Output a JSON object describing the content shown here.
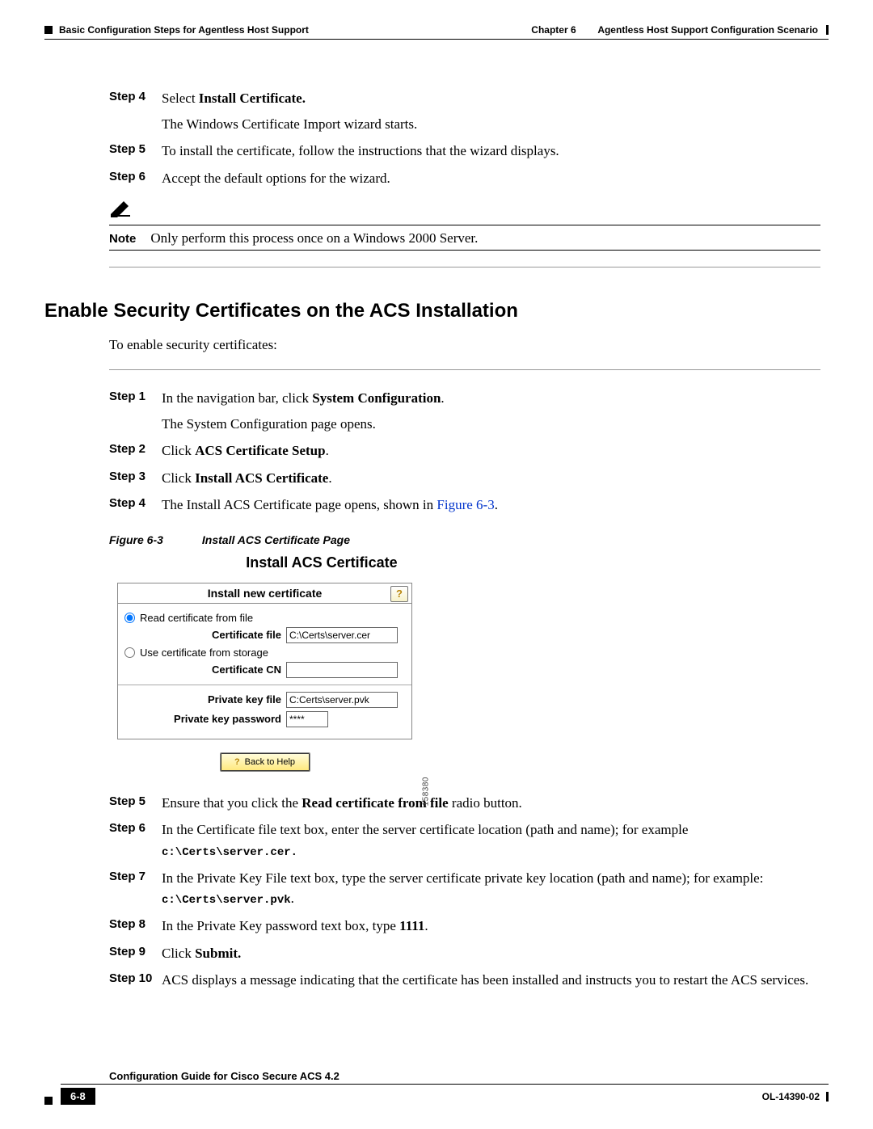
{
  "header": {
    "left": "Basic Configuration Steps for Agentless Host Support",
    "chapter": "Chapter 6",
    "title": "Agentless Host Support Configuration Scenario"
  },
  "section1": {
    "steps": {
      "s4": {
        "label": "Step 4",
        "pre": "Select ",
        "bold": "Install Certificate.",
        "post": "",
        "sub": "The Windows Certificate Import wizard starts."
      },
      "s5": {
        "label": "Step 5",
        "text": "To install the certificate, follow the instructions that the wizard displays."
      },
      "s6": {
        "label": "Step 6",
        "text": "Accept the default options for the wizard."
      }
    },
    "note": {
      "label": "Note",
      "text": "Only perform this process once on a Windows 2000 Server."
    }
  },
  "h2": "Enable Security Certificates on the ACS Installation",
  "section2_intro": "To enable security certificates:",
  "section2": {
    "s1": {
      "label": "Step 1",
      "pre": "In the navigation bar, click ",
      "bold": "System Configuration",
      "post": ".",
      "sub": "The System Configuration page opens."
    },
    "s2": {
      "label": "Step 2",
      "pre": "Click ",
      "bold": "ACS Certificate Setup",
      "post": "."
    },
    "s3": {
      "label": "Step 3",
      "pre": "Click ",
      "bold": "Install ACS Certificate",
      "post": "."
    },
    "s4": {
      "label": "Step 4",
      "pre": "The Install ACS Certificate page opens, shown in ",
      "link": "Figure 6-3",
      "post": "."
    }
  },
  "figure": {
    "num": "Figure 6-3",
    "caption": "Install ACS Certificate Page",
    "title": "Install ACS Certificate"
  },
  "cert": {
    "head": "Install new certificate",
    "help": "?",
    "radio1": "Read certificate from file",
    "cert_file_label": "Certificate file",
    "cert_file_value": "C:\\Certs\\server.cer",
    "radio2": "Use certificate from storage",
    "cert_cn_label": "Certificate CN",
    "cert_cn_value": "",
    "pk_file_label": "Private key file",
    "pk_file_value": "C:Certs\\server.pvk",
    "pk_pwd_label": "Private key password",
    "pk_pwd_value": "****",
    "back_help": "Back to Help",
    "side_num": "158380"
  },
  "section3": {
    "s5": {
      "label": "Step 5",
      "pre": "Ensure that you click the ",
      "bold": "Read certificate from file",
      "post": " radio button."
    },
    "s6": {
      "label": "Step 6",
      "pre": "In the Certificate file text box, enter the server certificate location (path and name); for example ",
      "mono": "c:\\Certs\\server.cer.",
      "post": ""
    },
    "s7": {
      "label": "Step 7",
      "pre": "In the Private Key File text box, type the server certificate private key location (path and name); for example: ",
      "mono": "c:\\Certs\\server.pvk",
      "post": "."
    },
    "s8": {
      "label": "Step 8",
      "pre": "In the Private Key password text box, type ",
      "bold": "1111",
      "post": "."
    },
    "s9": {
      "label": "Step 9",
      "pre": "Click ",
      "bold": "Submit.",
      "post": ""
    },
    "s10": {
      "label": "Step 10",
      "text": "ACS displays a message indicating that the certificate has been installed and instructs you to restart the ACS services."
    }
  },
  "footer": {
    "title": "Configuration Guide for Cisco Secure ACS 4.2",
    "page": "6-8",
    "code": "OL-14390-02"
  }
}
